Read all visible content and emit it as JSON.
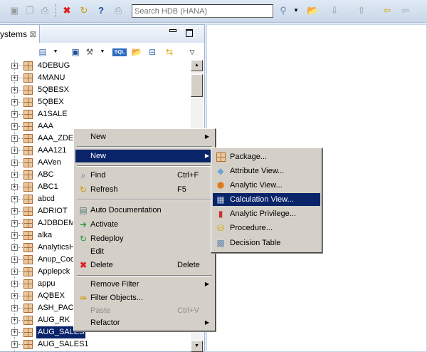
{
  "toolbar": {
    "search_placeholder": "Search HDB (HANA)",
    "icons": [
      "save-icon",
      "save-all-icon",
      "print-icon",
      "delete-icon",
      "refresh-icon",
      "help-icon",
      "print-icon",
      "search-icon",
      "open-folder-icon",
      "next-annotation-icon",
      "previous-annotation-icon",
      "last-edit-icon",
      "back-icon"
    ]
  },
  "panel": {
    "tab_label": "ystems",
    "tree_items": [
      "4DEBUG",
      "4MANU",
      "5QBESX",
      "5QBEX",
      "A1SALE",
      "AAA",
      "AAA_ZDEC",
      "AAA121",
      "AAVen",
      "ABC",
      "ABC1",
      "abcd",
      "ADRIOT",
      "AJDBDEMO",
      "alka",
      "AnalyticsH",
      "Anup_Cod",
      "Applepck",
      "appu",
      "AQBEX",
      "ASH_PACK",
      "AUG_RK",
      "AUG_SALES",
      "AUG_SALES1"
    ],
    "selected_item": "AUG_SALES",
    "sql_label": "SQL"
  },
  "context_menu": {
    "items": [
      {
        "label": "New",
        "shortcut": "",
        "submenu": true
      },
      {
        "label": "New",
        "shortcut": "",
        "submenu": true,
        "highlighted": true
      },
      {
        "label": "Find",
        "shortcut": "Ctrl+F"
      },
      {
        "label": "Refresh",
        "shortcut": "F5"
      },
      {
        "label": "Auto Documentation",
        "shortcut": ""
      },
      {
        "label": "Activate",
        "shortcut": ""
      },
      {
        "label": "Redeploy",
        "shortcut": ""
      },
      {
        "label": "Edit",
        "shortcut": ""
      },
      {
        "label": "Delete",
        "shortcut": "Delete"
      },
      {
        "label": "Remove Filter",
        "shortcut": "",
        "submenu": true
      },
      {
        "label": "Filter Objects...",
        "shortcut": ""
      },
      {
        "label": "Paste",
        "shortcut": "Ctrl+V",
        "disabled": true
      },
      {
        "label": "Refactor",
        "shortcut": "",
        "submenu": true
      }
    ]
  },
  "submenu": {
    "items": [
      "Package...",
      "Attribute View...",
      "Analytic View...",
      "Calculation View...",
      "Analytic Privilege...",
      "Procedure...",
      "Decision Table"
    ],
    "highlighted": "Calculation View..."
  },
  "colors": {
    "selection": "#0a246a",
    "menu_bg": "#d4d0c8",
    "toolbar_bg": "#d3e0ef"
  }
}
